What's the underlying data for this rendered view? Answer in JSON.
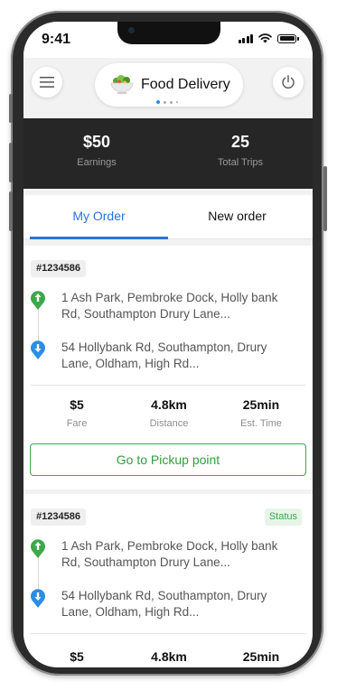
{
  "status_bar": {
    "time": "9:41"
  },
  "header": {
    "title": "Food Delivery",
    "menu_icon": "hamburger-menu-icon",
    "power_icon": "power-icon",
    "logo_icon": "salad-bowl-icon"
  },
  "stats": [
    {
      "value": "$50",
      "label": "Earnings"
    },
    {
      "value": "25",
      "label": "Total Trips"
    }
  ],
  "tabs": [
    {
      "label": "My Order",
      "active": true
    },
    {
      "label": "New order",
      "active": false
    }
  ],
  "orders": [
    {
      "id": "#1234586",
      "status": "",
      "pickup": "1 Ash Park, Pembroke Dock, Holly bank Rd, Southampton Drury Lane...",
      "dropoff": "54 Hollybank Rd, Southampton, Drury Lane, Oldham, High Rd...",
      "fare": "$5",
      "fare_label": "Fare",
      "distance": "4.8km",
      "distance_label": "Distance",
      "time": "25min",
      "time_label": "Est. Time",
      "action": "Go to Pickup point"
    },
    {
      "id": "#1234586",
      "status": "Status",
      "pickup": "1 Ash Park, Pembroke Dock, Holly bank Rd, Southampton Drury Lane...",
      "dropoff": "54 Hollybank Rd, Southampton, Drury Lane, Oldham, High Rd...",
      "fare": "$5",
      "distance": "4.8km",
      "time": "25min"
    }
  ],
  "colors": {
    "accent_blue": "#2a73d9",
    "pickup_green": "#3da84a",
    "dropoff_blue": "#2b8de6",
    "stats_bg": "#262626"
  }
}
